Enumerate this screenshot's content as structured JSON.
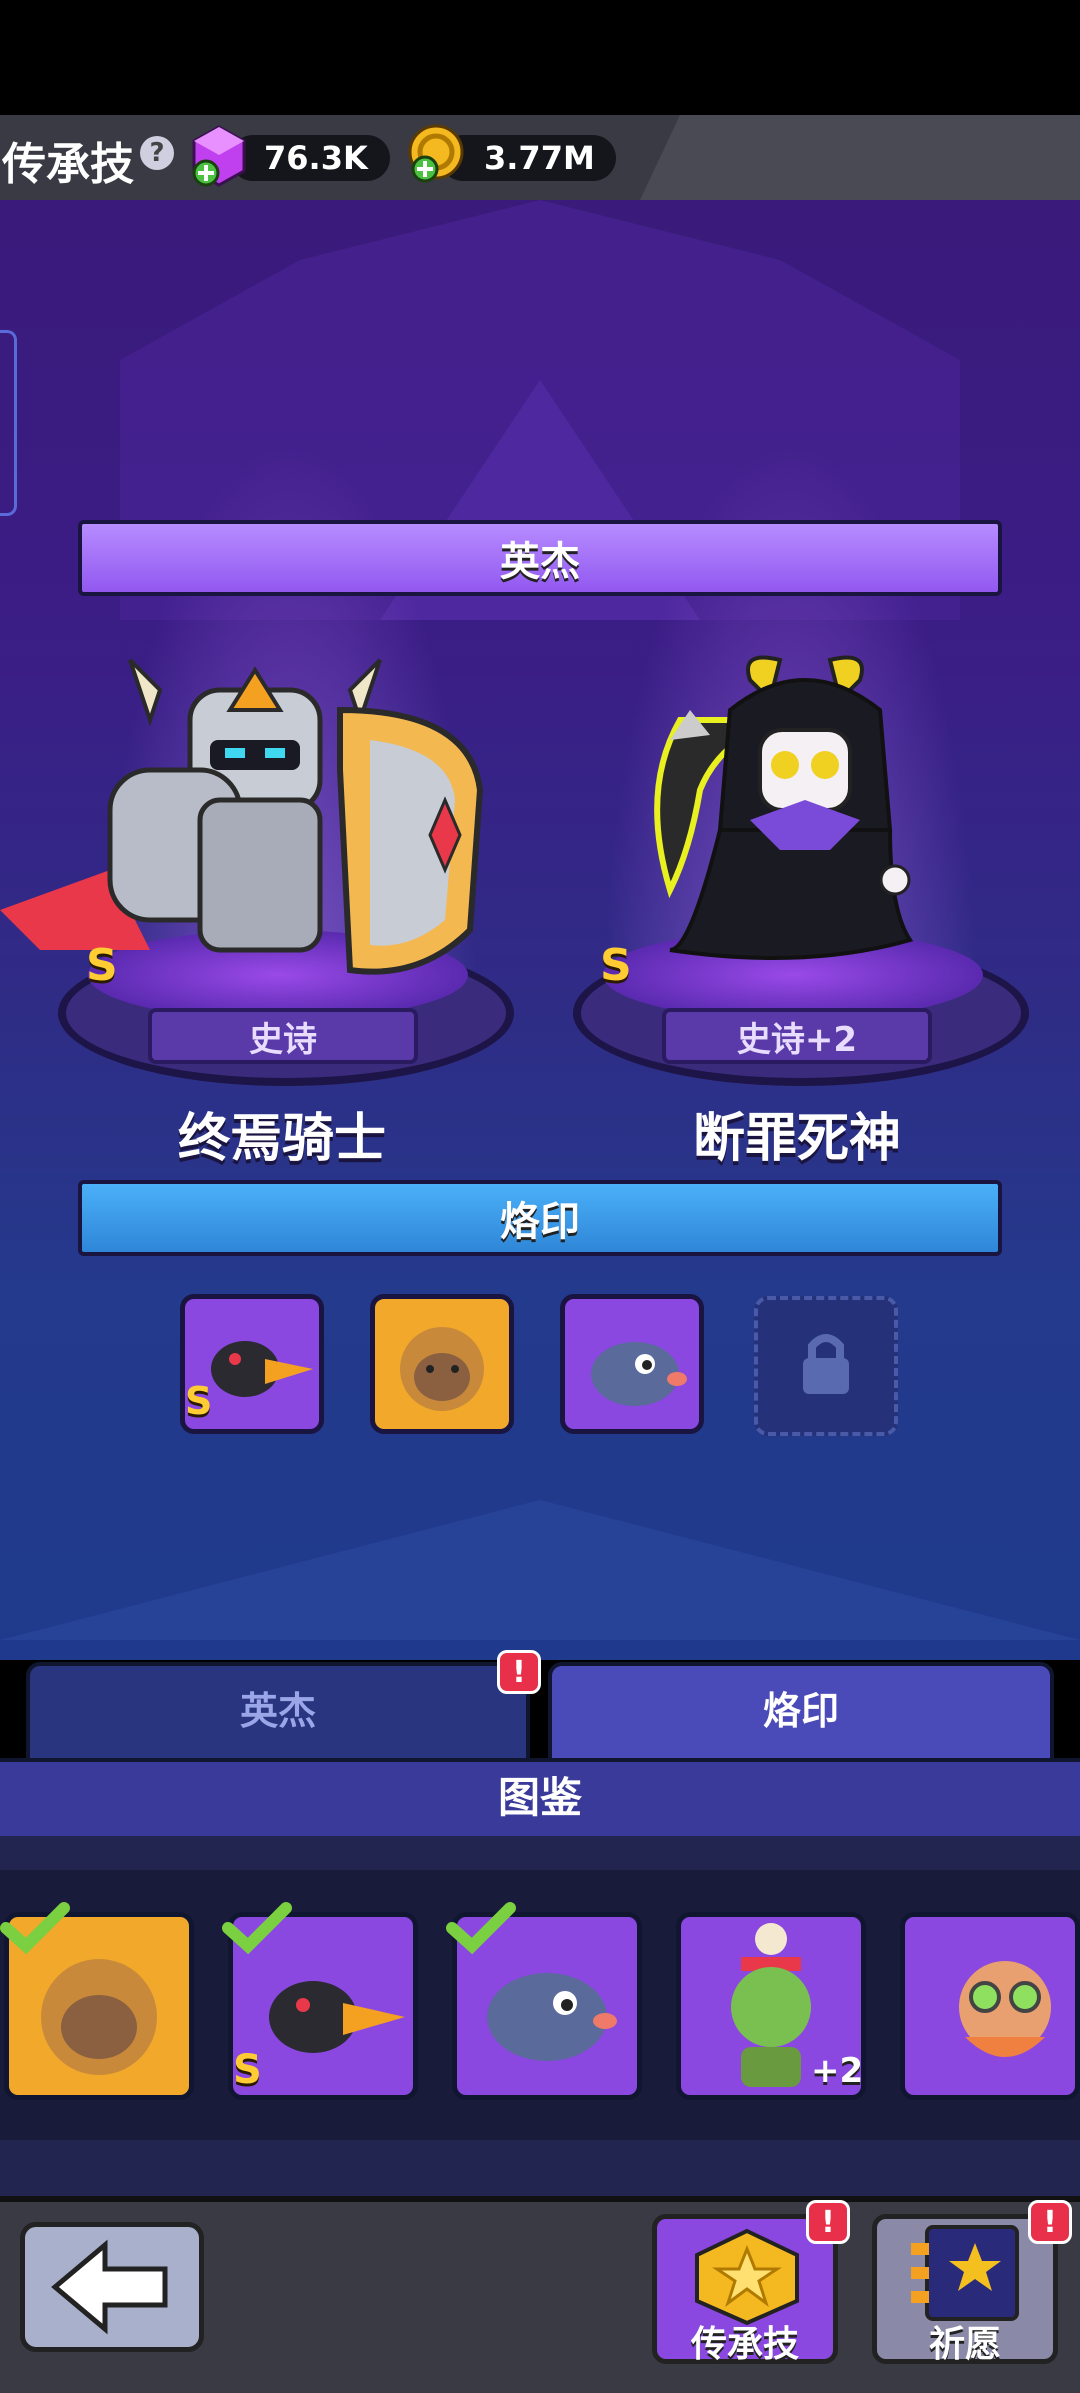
{
  "header": {
    "title": "传承技",
    "gems": "76.3K",
    "coins": "3.77M"
  },
  "hero_section": {
    "banner": "英杰",
    "heroes": [
      {
        "name": "终焉骑士",
        "rarity": "史诗",
        "grade": "S"
      },
      {
        "name": "断罪死神",
        "rarity": "史诗+2",
        "grade": "S"
      }
    ]
  },
  "brand_section": {
    "banner": "烙印",
    "slots": [
      {
        "kind": "purple",
        "grade": "S",
        "icon": "crow-icon"
      },
      {
        "kind": "gold",
        "grade": "",
        "icon": "monkey-icon"
      },
      {
        "kind": "purple",
        "grade": "",
        "icon": "fish-icon"
      },
      {
        "kind": "locked",
        "grade": "",
        "icon": "lock-icon"
      }
    ]
  },
  "tabs": {
    "hero": "英杰",
    "brand": "烙印",
    "hero_alert": "!"
  },
  "codex": {
    "title": "图鉴",
    "cards": [
      {
        "kind": "gold",
        "checked": true,
        "grade": "",
        "badge": ""
      },
      {
        "kind": "purple",
        "checked": true,
        "grade": "S",
        "badge": ""
      },
      {
        "kind": "purple",
        "checked": true,
        "grade": "",
        "badge": ""
      },
      {
        "kind": "purple",
        "checked": false,
        "grade": "",
        "badge": "+2"
      },
      {
        "kind": "purple",
        "checked": false,
        "grade": "",
        "badge": ""
      }
    ]
  },
  "footer": {
    "legacy_label": "传承技",
    "wish_label": "祈愿",
    "alert": "!"
  },
  "colors": {
    "accent_purple": "#9258f0",
    "accent_blue": "#2f86d8",
    "grade_gold": "#ffcc33",
    "alert_red": "#e8304a"
  }
}
